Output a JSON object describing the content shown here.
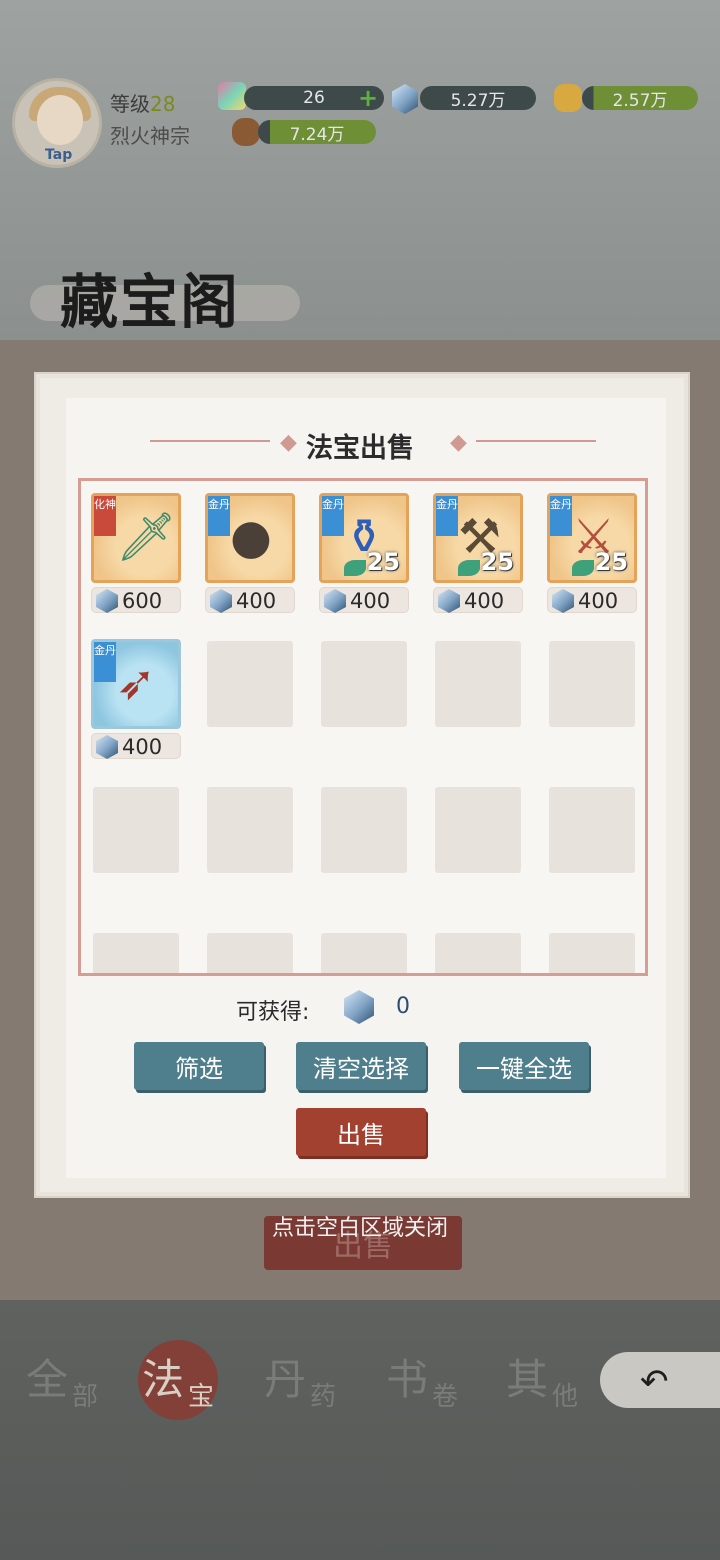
{
  "header": {
    "level_prefix": "等级",
    "level_value": "28",
    "sect_name": "烈火神宗",
    "resources": [
      {
        "name": "spirit-stone",
        "value": "26"
      },
      {
        "name": "crystal",
        "value": "5.27万"
      },
      {
        "name": "gold",
        "value": "2.57万"
      },
      {
        "name": "wood",
        "value": "7.24万"
      }
    ],
    "avatar_badge": "Tap"
  },
  "pavilion": {
    "title": "藏宝阁"
  },
  "modal": {
    "title": "法宝出售",
    "items": [
      {
        "rank": "化神",
        "rank_color": "red",
        "icon": "jade-dagger-icon",
        "price": "600",
        "level": ""
      },
      {
        "rank": "金丹",
        "rank_color": "blue",
        "icon": "bell-icon",
        "price": "400",
        "level": ""
      },
      {
        "rank": "金丹",
        "rank_color": "blue",
        "icon": "cauldron-icon",
        "price": "400",
        "level": "25"
      },
      {
        "rank": "金丹",
        "rank_color": "blue",
        "icon": "mace-icon",
        "price": "400",
        "level": "25"
      },
      {
        "rank": "金丹",
        "rank_color": "blue",
        "icon": "sword-icon",
        "price": "400",
        "level": "25"
      },
      {
        "rank": "金丹",
        "rank_color": "blue",
        "icon": "spear-icon",
        "price": "400",
        "level": ""
      }
    ],
    "gain_label": "可获得:",
    "gain_value": "0",
    "buttons": {
      "filter": "筛选",
      "clear": "清空选择",
      "select_all": "一键全选",
      "sell": "出售"
    },
    "close_hint": "点击空白区域关闭"
  },
  "background": {
    "sell_label": "出售",
    "tabs": [
      {
        "big": "全",
        "small": "部"
      },
      {
        "big": "法",
        "small": "宝"
      },
      {
        "big": "丹",
        "small": "药"
      },
      {
        "big": "书",
        "small": "卷"
      },
      {
        "big": "其",
        "small": "他"
      }
    ],
    "back_icon": "back-arrow-icon"
  },
  "colors": {
    "accent_red": "#a34131",
    "accent_teal": "#4f7f8d",
    "frame_pink": "#d69d95"
  }
}
